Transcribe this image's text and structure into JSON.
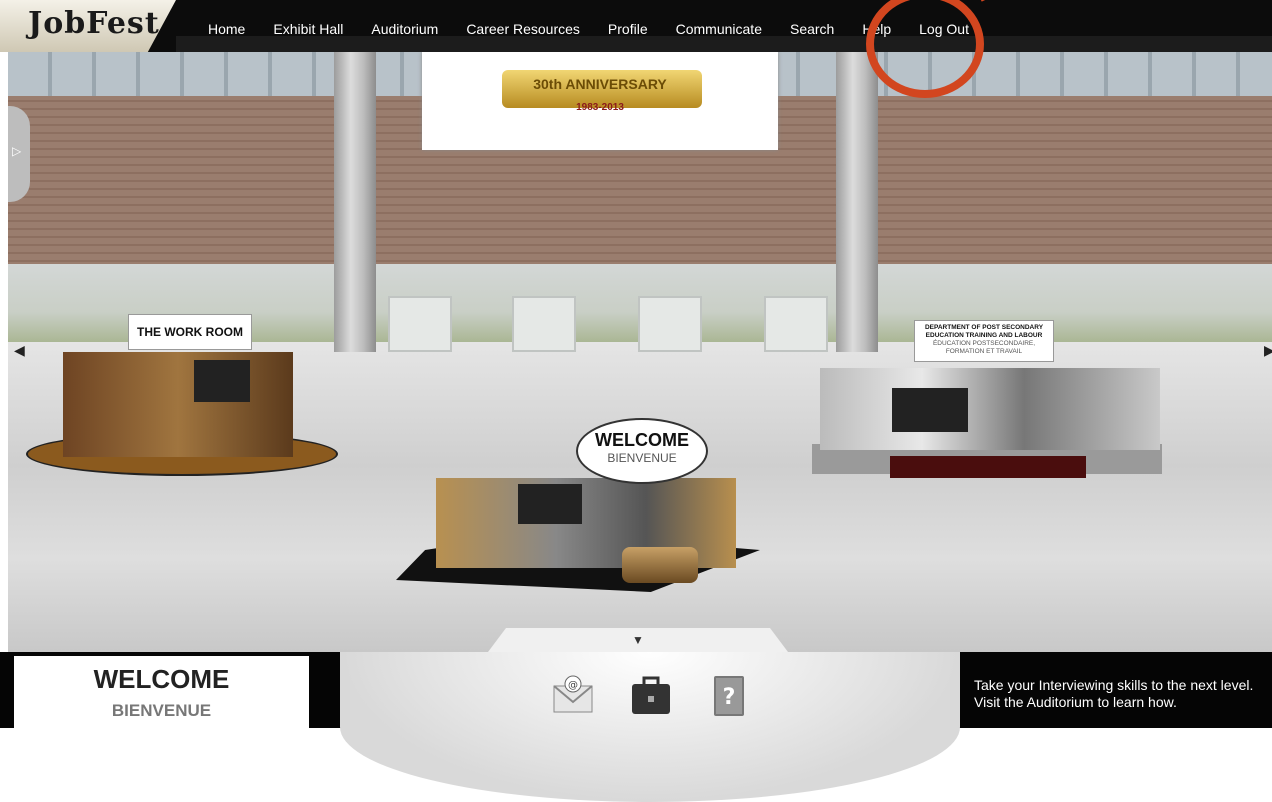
{
  "app": {
    "logo_text": "JobFest"
  },
  "nav": {
    "items": [
      "Home",
      "Exhibit Hall",
      "Auditorium",
      "Career Resources",
      "Profile",
      "Communicate",
      "Search",
      "Help",
      "Log Out"
    ]
  },
  "banner": {
    "ribbon_text": "30th ANNIVERSARY",
    "years": "1983-2013"
  },
  "booths": {
    "workroom_sign": "THE WORK ROOM",
    "welcome_main": "WELCOME",
    "welcome_sub": "BIENVENUE",
    "dept_sign_line1": "DEPARTMENT OF POST SECONDARY",
    "dept_sign_line2": "EDUCATION TRAINING AND LABOUR",
    "dept_sign_line3": "ÉDUCATION POSTSECONDAIRE,",
    "dept_sign_line4": "FORMATION ET TRAVAIL"
  },
  "bottom": {
    "welcome_main": "WELCOME",
    "welcome_sub": "BIENVENUE",
    "tip_text": "Take your Interviewing skills to the next level. Visit the Auditorium to learn how.",
    "icons": [
      "mail-icon",
      "briefcase-icon",
      "help-book-icon"
    ]
  },
  "annotation": {
    "color": "#d2461f"
  }
}
